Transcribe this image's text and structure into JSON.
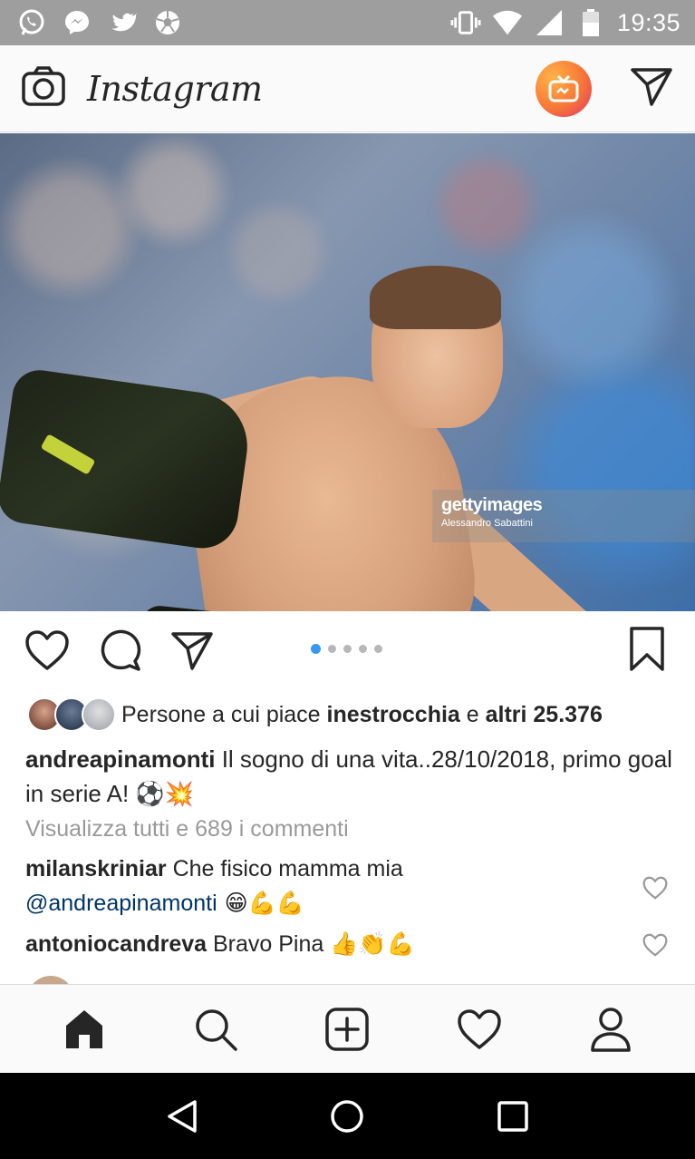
{
  "status_bar": {
    "time": "19:35",
    "left_icons": [
      "whatsapp-icon",
      "messenger-icon",
      "twitter-icon",
      "soccer-ball-icon"
    ],
    "right_icons": [
      "vibrate-icon",
      "wifi-icon",
      "signal-icon",
      "battery-icon"
    ]
  },
  "header": {
    "app_name": "Instagram",
    "icons": [
      "camera-icon",
      "igtv-icon",
      "direct-message-icon"
    ]
  },
  "post": {
    "image": {
      "watermark_brand": "gettyimages",
      "watermark_credit": "Alessandro Sabattini"
    },
    "carousel": {
      "count": 5,
      "active": 0
    },
    "likes": {
      "prefix": "Persone a cui piace ",
      "user": "inestrocchia",
      "conjunction": " e ",
      "others": "altri 25.376"
    },
    "caption": {
      "username": "andreapinamonti",
      "text": " Il sogno di una vita..28/10/2018, primo goal in serie A! ",
      "emoji": "⚽💥"
    },
    "view_all_comments": "Visualizza tutti e 689 i commenti",
    "comments": [
      {
        "username": "milanskriniar",
        "text": " Che fisico mamma mia",
        "mention": "@andreapinamonti",
        "emoji": " 😁💪💪"
      },
      {
        "username": "antoniocandreva",
        "text": " Bravo Pina ",
        "emoji": "👍👏💪"
      }
    ]
  },
  "tab_bar": [
    "home-icon",
    "search-icon",
    "new-post-icon",
    "activity-icon",
    "profile-icon"
  ],
  "nav_bar": [
    "back-icon",
    "home-circle-icon",
    "recents-icon"
  ],
  "colors": {
    "status_bar": "#9e9e9e",
    "header_bg": "#fafafa",
    "link_blue": "#003569",
    "active_dot": "#3897f0",
    "muted_text": "#999999"
  }
}
